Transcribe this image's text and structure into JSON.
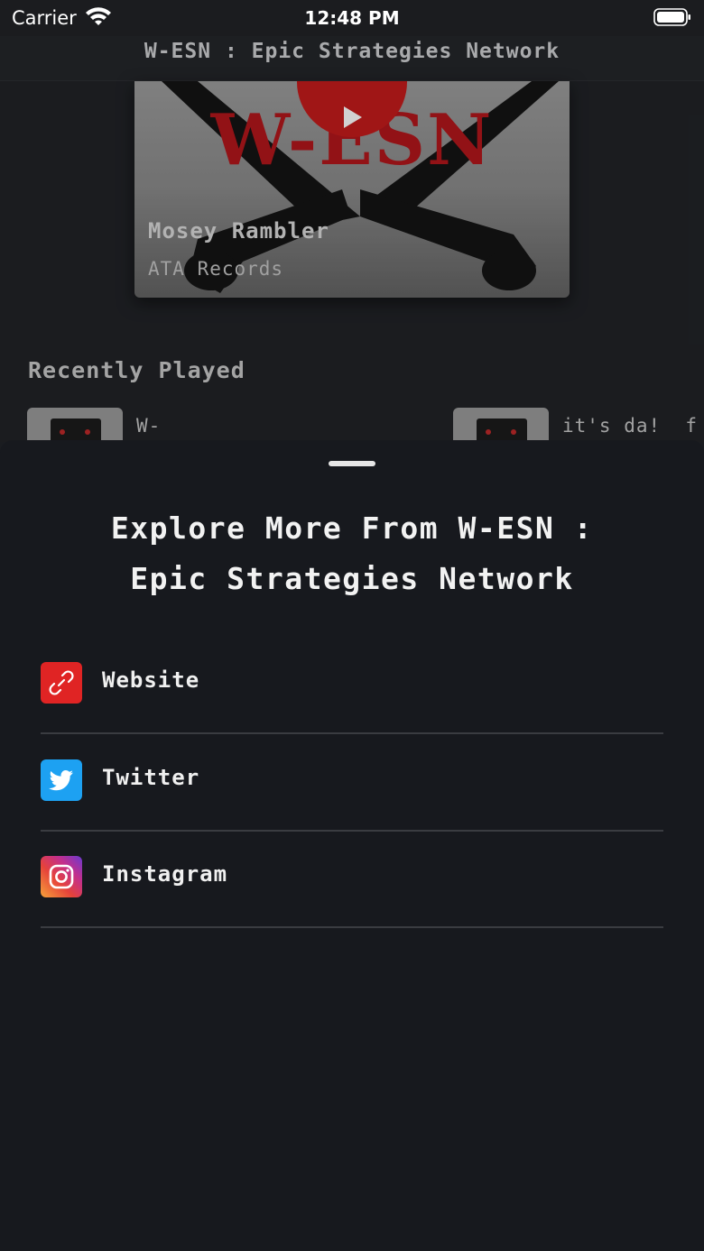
{
  "status_bar": {
    "carrier": "Carrier",
    "time": "12:48 PM"
  },
  "nav": {
    "title": "W-ESN : Epic Strategies Network"
  },
  "featured": {
    "title": "Mosey Rambler",
    "subtitle": "ATA Records",
    "art_text": "W-ESN"
  },
  "recently_played": {
    "heading": "Recently Played",
    "items": [
      {
        "label": "W-"
      },
      {
        "label": "it's da!  f"
      }
    ]
  },
  "sheet": {
    "title_line1": "Explore More From W-ESN :",
    "title_line2": "Epic Strategies Network",
    "links": [
      {
        "label": "Website",
        "icon": "link-icon",
        "color": "#e02424"
      },
      {
        "label": "Twitter",
        "icon": "twitter-icon",
        "color": "#1da1f2"
      },
      {
        "label": "Instagram",
        "icon": "instagram-icon",
        "color": "#e6433a"
      }
    ]
  }
}
